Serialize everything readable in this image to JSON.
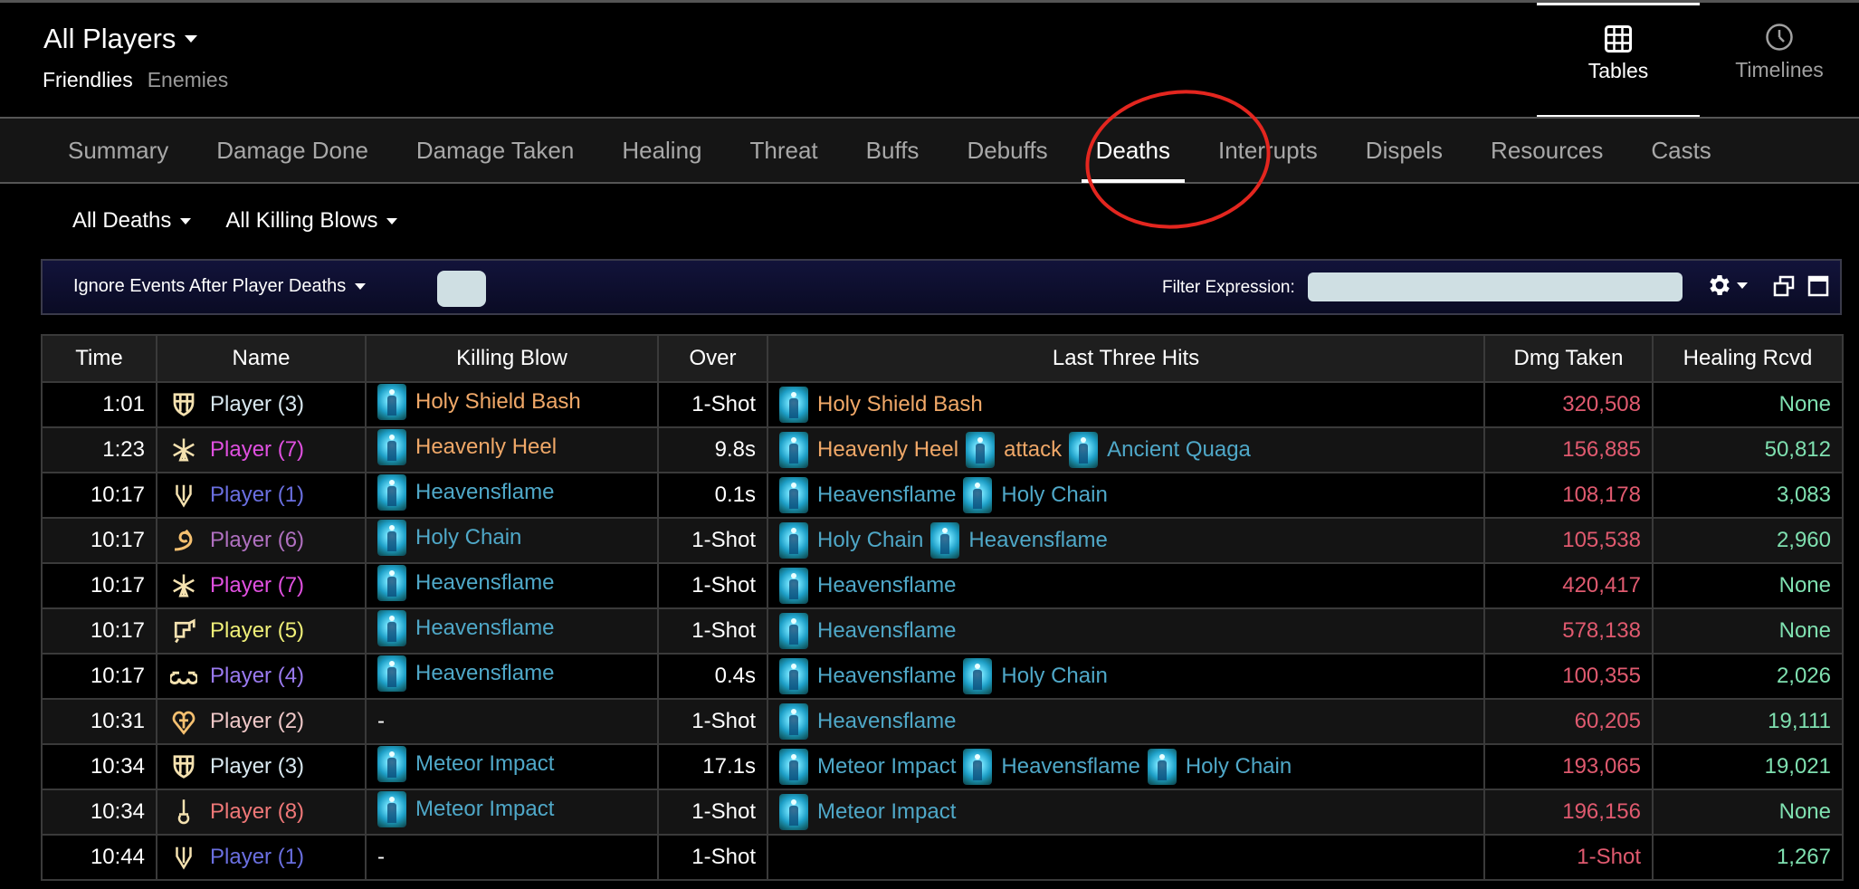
{
  "header": {
    "title": "All Players",
    "subnav": [
      {
        "label": "Friendlies",
        "active": true
      },
      {
        "label": "Enemies",
        "active": false
      }
    ],
    "view_switch": [
      {
        "label": "Tables",
        "icon": "grid-icon",
        "active": true
      },
      {
        "label": "Timelines",
        "icon": "clock-icon",
        "active": false
      }
    ]
  },
  "tabs": [
    {
      "label": "Summary",
      "active": false
    },
    {
      "label": "Damage Done",
      "active": false
    },
    {
      "label": "Damage Taken",
      "active": false
    },
    {
      "label": "Healing",
      "active": false
    },
    {
      "label": "Threat",
      "active": false
    },
    {
      "label": "Buffs",
      "active": false
    },
    {
      "label": "Debuffs",
      "active": false
    },
    {
      "label": "Deaths",
      "active": true
    },
    {
      "label": "Interrupts",
      "active": false
    },
    {
      "label": "Dispels",
      "active": false
    },
    {
      "label": "Resources",
      "active": false
    },
    {
      "label": "Casts",
      "active": false
    }
  ],
  "filters": {
    "deaths_dropdown": "All Deaths",
    "killing_blows_dropdown": "All Killing Blows"
  },
  "filterbar": {
    "ignore_events_dropdown": "Ignore Events After Player Deaths",
    "filter_label": "Filter Expression:",
    "filter_value": ""
  },
  "colors": {
    "ability_orange": "#f0a868",
    "ability_blue": "#4fa8c8",
    "dmg_taken": "#e05a6f",
    "healing": "#7fe0b0",
    "annotation": "#e3261f",
    "player_colors": {
      "1": "#6a6fe0",
      "2": "#f0c8c8",
      "3": "#d8e8f0",
      "4": "#9a7af0",
      "5": "#f0f078",
      "6": "#b070c0",
      "7": "#e050e0",
      "8": "#f07878"
    }
  },
  "table": {
    "columns": [
      "Time",
      "Name",
      "Killing Blow",
      "Over",
      "Last Three Hits",
      "Dmg Taken",
      "Healing Rcvd"
    ],
    "rows": [
      {
        "time": "1:01",
        "name": "Player (3)",
        "pid": "3",
        "job_icon": "shield-icon",
        "killing_blow": {
          "name": "Holy Shield Bash",
          "color": "orange"
        },
        "over": "1-Shot",
        "hits": [
          {
            "name": "Holy Shield Bash",
            "color": "orange"
          }
        ],
        "dmg_taken": "320,508",
        "healing": "None"
      },
      {
        "time": "1:23",
        "name": "Player (7)",
        "pid": "7",
        "job_icon": "star-icon",
        "killing_blow": {
          "name": "Heavenly Heel",
          "color": "orange"
        },
        "over": "9.8s",
        "hits": [
          {
            "name": "Heavenly Heel",
            "color": "orange"
          },
          {
            "name": "attack",
            "color": "orange"
          },
          {
            "name": "Ancient Quaga",
            "color": "blue"
          }
        ],
        "dmg_taken": "156,885",
        "healing": "50,812"
      },
      {
        "time": "10:17",
        "name": "Player (1)",
        "pid": "1",
        "job_icon": "trident-icon",
        "killing_blow": {
          "name": "Heavensflame",
          "color": "blue"
        },
        "over": "0.1s",
        "hits": [
          {
            "name": "Heavensflame",
            "color": "blue"
          },
          {
            "name": "Holy Chain",
            "color": "blue"
          }
        ],
        "dmg_taken": "108,178",
        "healing": "3,083"
      },
      {
        "time": "10:17",
        "name": "Player (6)",
        "pid": "6",
        "job_icon": "swirl-icon",
        "killing_blow": {
          "name": "Holy Chain",
          "color": "blue"
        },
        "over": "1-Shot",
        "hits": [
          {
            "name": "Holy Chain",
            "color": "blue"
          },
          {
            "name": "Heavensflame",
            "color": "blue"
          }
        ],
        "dmg_taken": "105,538",
        "healing": "2,960"
      },
      {
        "time": "10:17",
        "name": "Player (7)",
        "pid": "7",
        "job_icon": "star-icon",
        "killing_blow": {
          "name": "Heavensflame",
          "color": "blue"
        },
        "over": "1-Shot",
        "hits": [
          {
            "name": "Heavensflame",
            "color": "blue"
          }
        ],
        "dmg_taken": "420,417",
        "healing": "None"
      },
      {
        "time": "10:17",
        "name": "Player (5)",
        "pid": "5",
        "job_icon": "gun-icon",
        "killing_blow": {
          "name": "Heavensflame",
          "color": "blue"
        },
        "over": "1-Shot",
        "hits": [
          {
            "name": "Heavensflame",
            "color": "blue"
          }
        ],
        "dmg_taken": "578,138",
        "healing": "None"
      },
      {
        "time": "10:17",
        "name": "Player (4)",
        "pid": "4",
        "job_icon": "rings-icon",
        "killing_blow": {
          "name": "Heavensflame",
          "color": "blue"
        },
        "over": "0.4s",
        "hits": [
          {
            "name": "Heavensflame",
            "color": "blue"
          },
          {
            "name": "Holy Chain",
            "color": "blue"
          }
        ],
        "dmg_taken": "100,355",
        "healing": "2,026"
      },
      {
        "time": "10:31",
        "name": "Player (2)",
        "pid": "2",
        "job_icon": "heart-icon",
        "killing_blow": null,
        "killing_blow_text": "-",
        "over": "1-Shot",
        "hits": [
          {
            "name": "Heavensflame",
            "color": "blue"
          }
        ],
        "dmg_taken": "60,205",
        "healing": "19,111"
      },
      {
        "time": "10:34",
        "name": "Player (3)",
        "pid": "3",
        "job_icon": "shield-icon",
        "killing_blow": {
          "name": "Meteor Impact",
          "color": "blue"
        },
        "over": "17.1s",
        "hits": [
          {
            "name": "Meteor Impact",
            "color": "blue"
          },
          {
            "name": "Heavensflame",
            "color": "blue"
          },
          {
            "name": "Holy Chain",
            "color": "blue"
          }
        ],
        "dmg_taken": "193,065",
        "healing": "19,021"
      },
      {
        "time": "10:34",
        "name": "Player (8)",
        "pid": "8",
        "job_icon": "sword-icon",
        "killing_blow": {
          "name": "Meteor Impact",
          "color": "blue"
        },
        "over": "1-Shot",
        "hits": [
          {
            "name": "Meteor Impact",
            "color": "blue"
          }
        ],
        "dmg_taken": "196,156",
        "healing": "None"
      },
      {
        "time": "10:44",
        "name": "Player (1)",
        "pid": "1",
        "job_icon": "trident-icon",
        "killing_blow": null,
        "killing_blow_text": "-",
        "over": "1-Shot",
        "hits": [],
        "dmg_taken": "1-Shot",
        "healing": "1,267"
      }
    ]
  }
}
